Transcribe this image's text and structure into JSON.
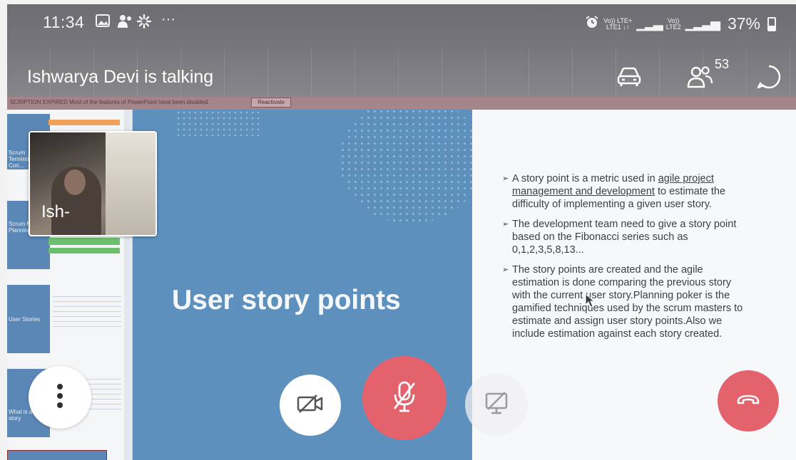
{
  "status_bar": {
    "time": "11:34",
    "network_1": "Vo)) LTE+",
    "network_1_sub": "LTE1 ↓↑",
    "network_2": "Vo))",
    "network_2_sub": "LTE2",
    "battery": "37%",
    "more_indicator": "···"
  },
  "call_header": {
    "speaker_status": "Ishwarya Devi is talking",
    "participant_count": "53"
  },
  "presentation": {
    "subscription_notice": "SCRIPTION EXPIRED  Most of the features of PowerPoint have been disabled.",
    "reactivate_label": "Reactivate",
    "thumbnails": [
      {
        "text": "Scrum Terminology Con..."
      },
      {
        "text": "Scrum Master Planning"
      },
      {
        "text": "User Stories"
      },
      {
        "text": "What is a user story"
      }
    ],
    "slide_title": "User story points",
    "bullets": [
      {
        "pre": "A story point is a metric used in ",
        "link": "agile project management and development",
        "post": " to estimate the difficulty of implementing a given user story."
      },
      {
        "pre": "The development team need to give a story point based on the Fibonacci series such as 0,1,2,3,5,8,13...",
        "link": "",
        "post": ""
      },
      {
        "pre": "The story points are created and the agile estimation is done comparing the previous story with the current user story.Planning poker is the gamified techniques used by the scrum masters to estimate and assign user story points.Also we include estimation against each story created.",
        "link": "",
        "post": ""
      }
    ]
  },
  "self_video": {
    "name_label": "Ish-"
  },
  "colors": {
    "slide_blue": "#5e90be",
    "end_call_red": "#e4626c",
    "header_gray": "#77767a"
  },
  "icons": {
    "gallery": "image-icon",
    "teams": "people-icon",
    "settings": "gear-icon",
    "alarm": "alarm-icon",
    "car_mode": "car-icon",
    "participants": "participants-icon",
    "chat": "chat-icon",
    "more": "more-vertical-icon",
    "video_off": "video-off-icon",
    "mic_off": "mic-off-icon",
    "share_off": "share-screen-off-icon",
    "hang_up": "hang-up-icon"
  }
}
